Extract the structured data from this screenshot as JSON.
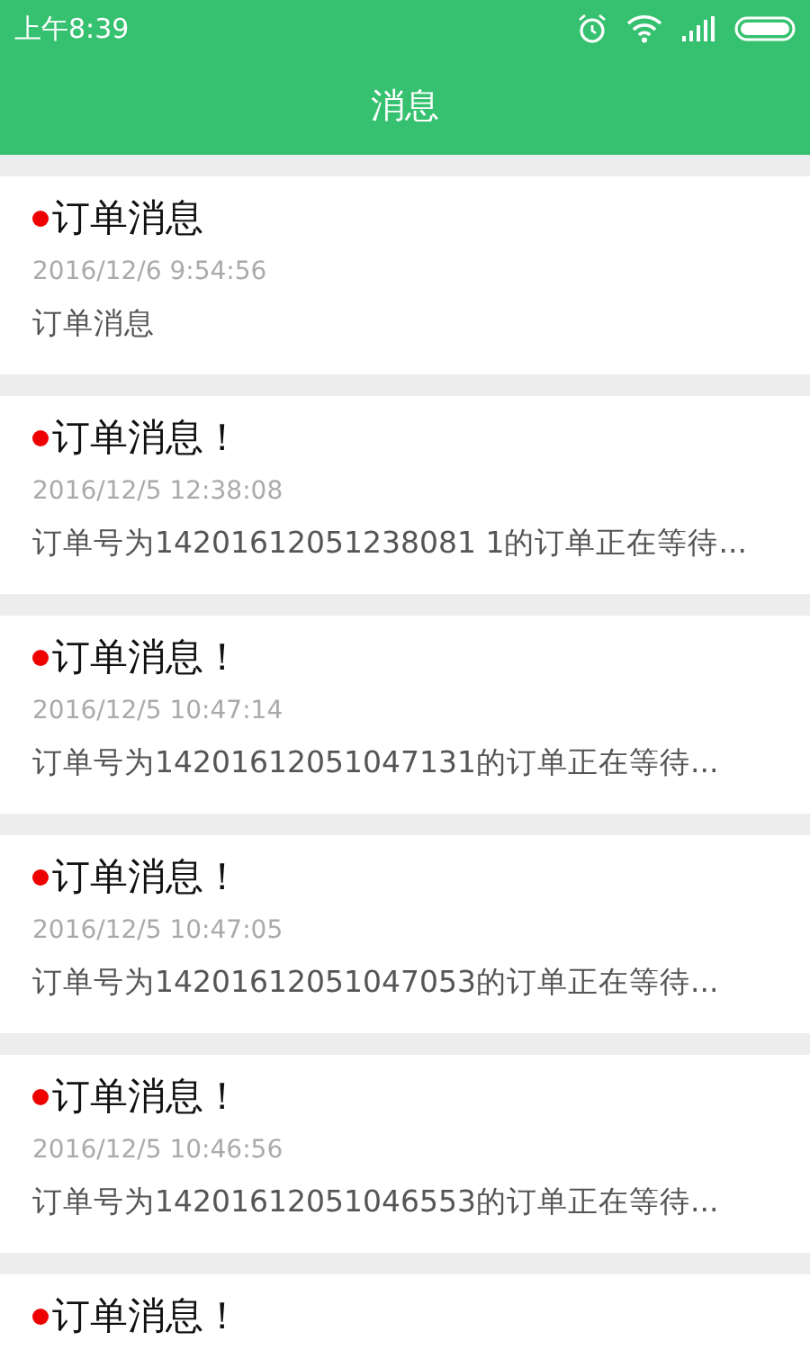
{
  "status_bar": {
    "time": "上午8:39"
  },
  "header": {
    "title": "消息"
  },
  "messages": [
    {
      "title": "订单消息",
      "unread": true,
      "time": "2016/12/6 9:54:56",
      "body": "订单消息"
    },
    {
      "title": "订单消息！",
      "unread": true,
      "time": "2016/12/5 12:38:08",
      "body": "订单号为14201612051238081 1的订单正在等待..."
    },
    {
      "title": "订单消息！",
      "unread": true,
      "time": "2016/12/5 10:47:14",
      "body": "订单号为14201612051047131的订单正在等待..."
    },
    {
      "title": "订单消息！",
      "unread": true,
      "time": "2016/12/5 10:47:05",
      "body": "订单号为14201612051047053的订单正在等待..."
    },
    {
      "title": "订单消息！",
      "unread": true,
      "time": "2016/12/5 10:46:56",
      "body": "订单号为14201612051046553的订单正在等待..."
    },
    {
      "title": "订单消息！",
      "unread": true
    }
  ]
}
